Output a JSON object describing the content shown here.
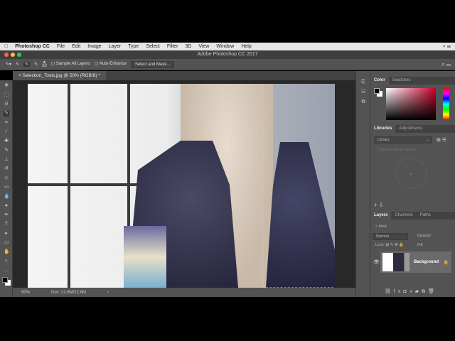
{
  "menubar": {
    "apple": "",
    "app": "Photoshop CC",
    "items": [
      "File",
      "Edit",
      "Image",
      "Layer",
      "Type",
      "Select",
      "Filter",
      "3D",
      "View",
      "Window",
      "Help"
    ]
  },
  "window": {
    "title": "Adobe Photoshop CC 2017"
  },
  "options": {
    "brush_size": "30",
    "sample_all_layers": "Sample All Layers",
    "auto_enhance": "Auto-Enhance",
    "select_and_mask": "Select and Mask..."
  },
  "document": {
    "tab": "Selection_Tools.jpg @ 50% (RGB/8) *",
    "zoom": "50%",
    "doc_info": "Doc: 22.8M/22.8M"
  },
  "color_panel": {
    "tabs": [
      "Color",
      "Swatches"
    ],
    "accent": "#c8002a"
  },
  "libraries_panel": {
    "tabs": [
      "Libraries",
      "Adjustments"
    ],
    "library_select": "Library",
    "search_placeholder": "Search Adobe Stock"
  },
  "layers_panel": {
    "tabs": [
      "Layers",
      "Channels",
      "Paths"
    ],
    "kind": "Kind",
    "blend": "Normal",
    "opacity": "Opacity:",
    "lock": "Lock:",
    "fill": "Fill:",
    "layers": [
      {
        "name": "Background",
        "visible": true,
        "locked": true
      }
    ]
  }
}
